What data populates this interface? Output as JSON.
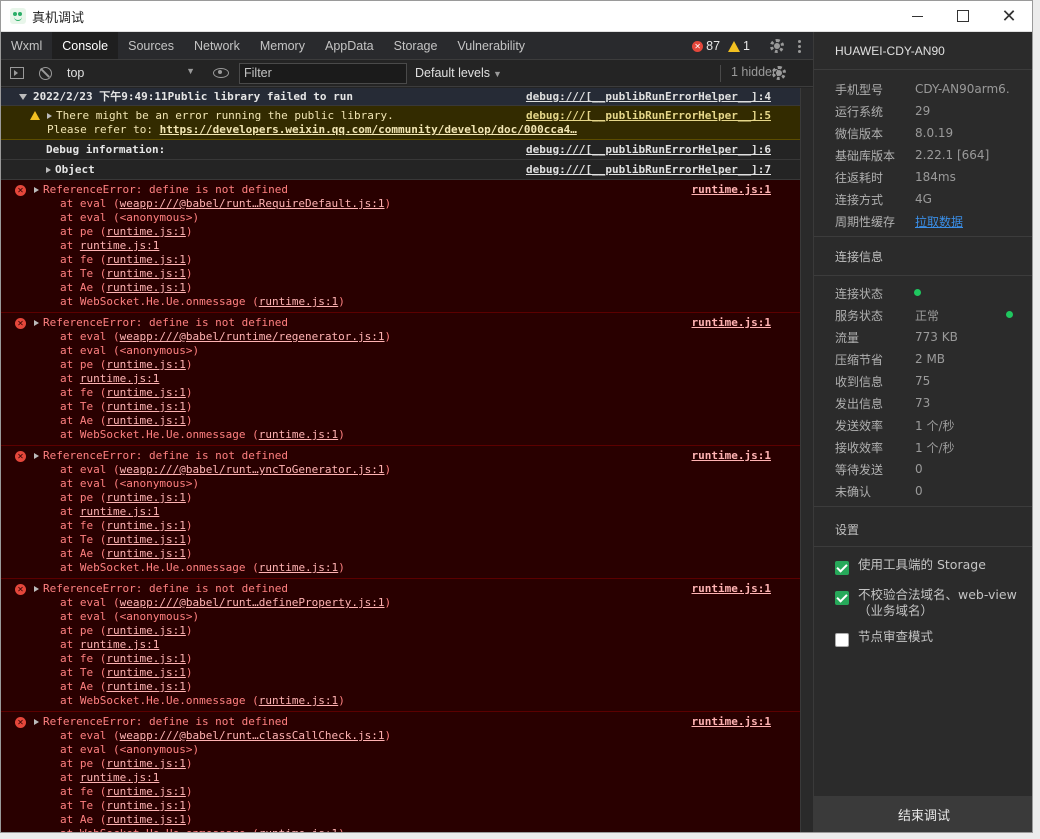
{
  "window": {
    "title": "真机调试"
  },
  "tabs": [
    "Wxml",
    "Console",
    "Sources",
    "Network",
    "Memory",
    "AppData",
    "Storage",
    "Vulnerability"
  ],
  "counts": {
    "errors": "87",
    "warnings": "1"
  },
  "toolbar": {
    "context": "top",
    "filter_placeholder": "Filter",
    "levels": "Default levels",
    "hidden": "1 hidden"
  },
  "console": {
    "group": {
      "title": "2022/2/23 下午9:49:11Public library failed to run",
      "src": "debug:///[__publibRunErrorHelper__]:4"
    },
    "warning": {
      "line1": "There might be an error running the public library.",
      "line2_prefix": "Please refer to: ",
      "url": "https://developers.weixin.qq.com/community/develop/doc/000cca4…",
      "src": "debug:///[__publibRunErrorHelper__]:5"
    },
    "debug_info": {
      "text": "Debug information:",
      "src": "debug:///[__publibRunErrorHelper__]:6"
    },
    "object": {
      "text": "Object",
      "src": "debug:///[__publibRunErrorHelper__]:7"
    },
    "errors": [
      {
        "message": "ReferenceError: define is not defined",
        "src": "runtime.js:1",
        "first_frame": "weapp:///@babel/runt…RequireDefault.js:1"
      },
      {
        "message": "ReferenceError: define is not defined",
        "src": "runtime.js:1",
        "first_frame": "weapp:///@babel/runtime/regenerator.js:1"
      },
      {
        "message": "ReferenceError: define is not defined",
        "src": "runtime.js:1",
        "first_frame": "weapp:///@babel/runt…yncToGenerator.js:1"
      },
      {
        "message": "ReferenceError: define is not defined",
        "src": "runtime.js:1",
        "first_frame": "weapp:///@babel/runt…defineProperty.js:1"
      },
      {
        "message": "ReferenceError: define is not defined",
        "src": "runtime.js:1",
        "first_frame": "weapp:///@babel/runt…classCallCheck.js:1"
      }
    ],
    "frames": {
      "at": "at",
      "eval": "eval",
      "anonymous": "(<anonymous>)",
      "pe": "pe",
      "fe": "fe",
      "te": "Te",
      "ae": "Ae",
      "ws": "WebSocket.He.Ue.onmessage",
      "runtime": "runtime.js:1"
    }
  },
  "panel": {
    "device": "HUAWEI-CDY-AN90",
    "info": [
      {
        "k": "手机型号",
        "v": "CDY-AN90arm6…"
      },
      {
        "k": "运行系统",
        "v": "29"
      },
      {
        "k": "微信版本",
        "v": "8.0.19"
      },
      {
        "k": "基础库版本",
        "v": "2.22.1 [664]"
      },
      {
        "k": "往返耗时",
        "v": "184ms"
      },
      {
        "k": "连接方式",
        "v": "4G"
      },
      {
        "k": "周期性缓存",
        "v": "拉取数据"
      }
    ],
    "conn_title": "连接信息",
    "conn": [
      {
        "k": "连接状态",
        "v": ""
      },
      {
        "k": "服务状态",
        "v": "正常"
      },
      {
        "k": "流量",
        "v": "773 KB"
      },
      {
        "k": "压缩节省",
        "v": "2 MB"
      },
      {
        "k": "收到信息",
        "v": "75"
      },
      {
        "k": "发出信息",
        "v": "73"
      },
      {
        "k": "发送效率",
        "v": "1 个/秒"
      },
      {
        "k": "接收效率",
        "v": "1 个/秒"
      },
      {
        "k": "等待发送",
        "v": "0"
      },
      {
        "k": "未确认",
        "v": "0"
      }
    ],
    "settings_title": "设置",
    "settings": [
      {
        "label": "使用工具端的 Storage",
        "checked": true
      },
      {
        "label": "不校验合法域名、web-view（业务域名）",
        "checked": true
      },
      {
        "label": "节点审查模式",
        "checked": false
      }
    ],
    "end_button": "结束调试"
  },
  "colors": {
    "error_bg": "#290000",
    "warning_bg": "#332b00",
    "accent_green": "#27a95a",
    "link_blue": "#3a8ee6"
  }
}
